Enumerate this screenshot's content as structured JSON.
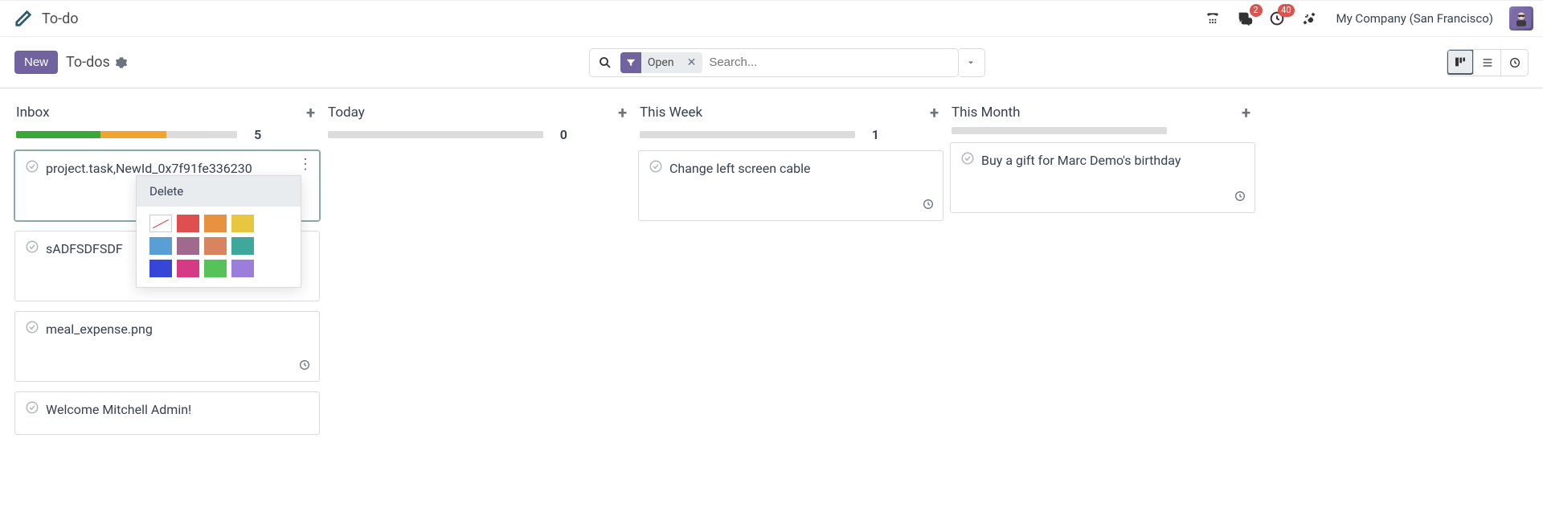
{
  "header": {
    "app_title": "To-do",
    "company": "My Company (San Francisco)",
    "messaging_badge": "2",
    "activities_badge": "40"
  },
  "control": {
    "new_label": "New",
    "breadcrumb": "To-dos",
    "search_placeholder": "Search...",
    "facet_label": "Open"
  },
  "dropdown": {
    "delete_label": "Delete",
    "colors": [
      "none",
      "#e04f4f",
      "#e8913f",
      "#e8c63f",
      "#5a9fd4",
      "#a06a8f",
      "#d8855f",
      "#3fa89c",
      "#3646d6",
      "#d63a84",
      "#58c25a",
      "#9b7ddb"
    ]
  },
  "columns": [
    {
      "title": "Inbox",
      "count": "5",
      "progress": [
        {
          "color": "#3aa836",
          "pct": 38
        },
        {
          "color": "#f0a42f",
          "pct": 30
        },
        {
          "color": "#dcdcdc",
          "pct": 18
        }
      ],
      "show_progress_partial": true,
      "cards": [
        {
          "title": "project.task,NewId_0x7f91fe336230",
          "selected": true,
          "kebab": true,
          "tall": true
        },
        {
          "title": "sADFSDFSDF",
          "tall": true
        },
        {
          "title": "meal_expense.png",
          "tall": true,
          "clock": true
        },
        {
          "title": "Welcome Mitchell Admin!"
        }
      ]
    },
    {
      "title": "Today",
      "count": "0",
      "progress": [
        {
          "color": "#dcdcdc",
          "pct": 100
        }
      ],
      "progress_width": 72,
      "cards": []
    },
    {
      "title": "This Week",
      "count": "1",
      "progress": [
        {
          "color": "#dcdcdc",
          "pct": 100
        }
      ],
      "progress_width": 72,
      "cards": [
        {
          "title": "Change left screen cable",
          "tall": true,
          "clock": true
        }
      ]
    },
    {
      "title": "This Month",
      "count": "",
      "progress": [
        {
          "color": "#dcdcdc",
          "pct": 100
        }
      ],
      "progress_width": 72,
      "no_count": true,
      "cards": [
        {
          "title": "Buy a gift for Marc Demo's birthday",
          "tall": true,
          "clock": true
        }
      ]
    }
  ]
}
